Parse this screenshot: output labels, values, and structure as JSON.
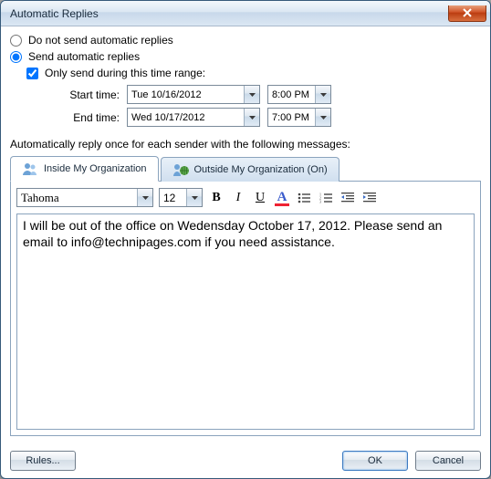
{
  "window": {
    "title": "Automatic Replies"
  },
  "options": {
    "dont_send_label": "Do not send automatic replies",
    "send_label": "Send automatic replies",
    "time_range_label": "Only send during this time range:",
    "start_label": "Start time:",
    "end_label": "End time:",
    "start_date": "Tue 10/16/2012",
    "start_time": "8:00 PM",
    "end_date": "Wed 10/17/2012",
    "end_time": "7:00 PM"
  },
  "section_label": "Automatically reply once for each sender with the following messages:",
  "tabs": {
    "inside_label": "Inside My Organization",
    "outside_label": "Outside My Organization (On)"
  },
  "editor": {
    "font": "Tahoma",
    "size": "12",
    "B": "B",
    "I": "I",
    "U": "U",
    "A": "A",
    "body": "I will be out of the office on Wedensday October 17, 2012. Please send an email to info@technipages.com if you need assistance."
  },
  "footer": {
    "rules_label": "Rules...",
    "ok_label": "OK",
    "cancel_label": "Cancel"
  }
}
